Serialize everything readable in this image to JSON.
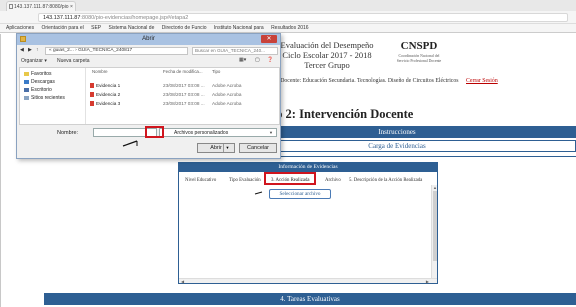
{
  "browser": {
    "tab_title": "143.137.111.87:8080/pio ×",
    "url_main": "143.137.111.87",
    "url_rest": ":8080/pio-evidencias/homepage.jsp#/etapa2",
    "back_icon": "arrow-left-icon",
    "forward_icon": "arrow-right-icon",
    "reload_icon": "reload-icon",
    "bookmarks": [
      "Aplicaciones",
      "Orientación para el",
      "SEP",
      "Sistema Nacional de",
      "Directorio de Funcio",
      "Instituto Nacional para",
      "Resultados 2016"
    ]
  },
  "header": {
    "title_line1": "Evaluación del Desempeño",
    "title_line2": "Ciclo Escolar 2017 - 2018",
    "title_line3": "Tercer Grupo",
    "brand": "CNSPD",
    "brand_sub1": "Coordinación Nacional del",
    "brand_sub2": "Servicio Profesional Docente",
    "nav_text": "ate   Docente: Educación Secundaria. Tecnologías. Diseño de Circuitos Eléctricos",
    "logout": "Cerrar Sesión"
  },
  "main": {
    "section_title": "to 2: Intervención Docente",
    "instrucciones": "Instrucciones",
    "carga": "Carga de Evidencias",
    "panel_title": "Información de Evidencias",
    "tabs": [
      "Nivel Educativo",
      "Tipo Evaluación",
      "3. Acción Realizada",
      "Archivo",
      "5. Descripción de la Acción Realizada"
    ],
    "select_button": "Seleccionar archivo",
    "tareas": "4. Tareas Evaluativas"
  },
  "dialog": {
    "title": "Abrir",
    "breadcrumb": "« guias_2... › GUIA_TECNICA_240817",
    "search_placeholder": "Buscar en GUIA_TECNICA_240...",
    "organize": "Organizar ▾",
    "new_folder": "Nueva carpeta",
    "sidebar": [
      "Favoritos",
      "Descargas",
      "Escritorio",
      "Sitios recientes"
    ],
    "columns": [
      "Nombre",
      "Fecha de modifica...",
      "Tipo"
    ],
    "files": [
      {
        "name": "Evidencia 1",
        "date": "23/08/2017 03:08 ...",
        "type": "Adobe Acroba"
      },
      {
        "name": "Evidencia 2",
        "date": "23/08/2017 03:08 ...",
        "type": "Adobe Acroba"
      },
      {
        "name": "Evidencia 3",
        "date": "23/08/2017 03:08 ...",
        "type": "Adobe Acroba"
      }
    ],
    "filename_label": "Nombre:",
    "filetype": "Archivos personalizados",
    "open_button": "Abrir",
    "cancel_button": "Cancelar"
  }
}
